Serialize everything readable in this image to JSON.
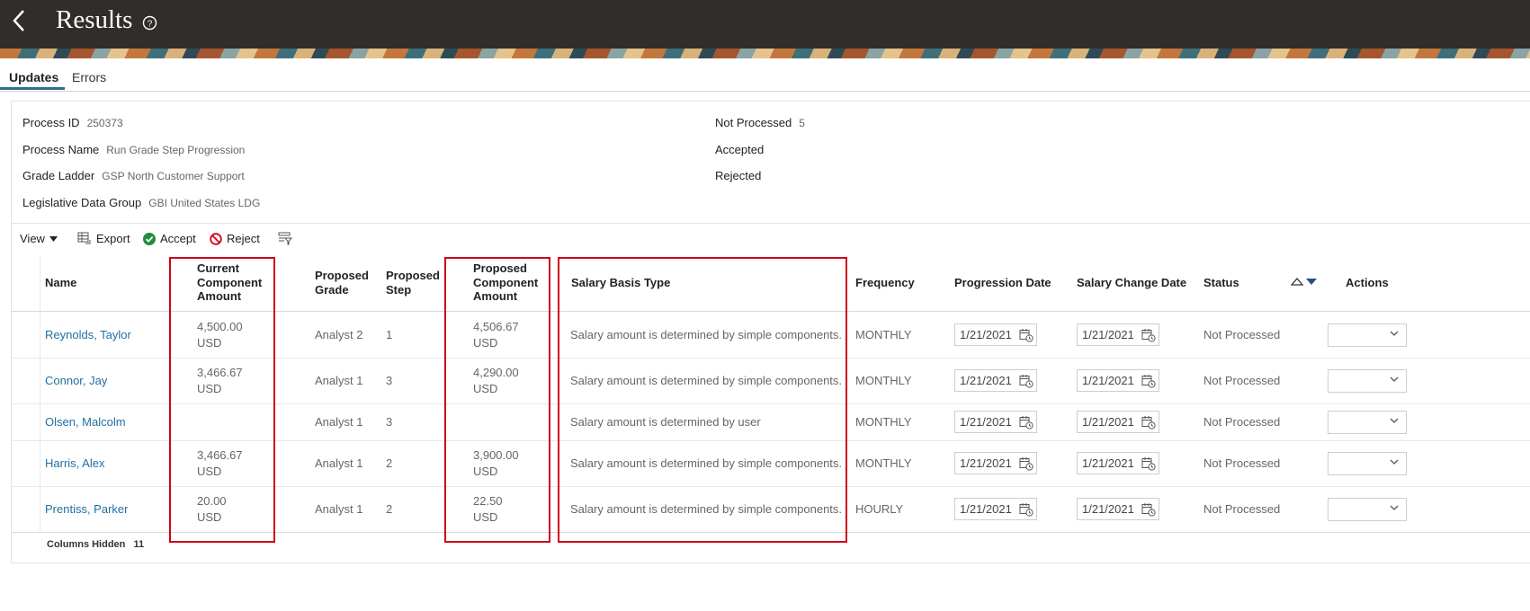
{
  "header": {
    "title": "Results"
  },
  "tabs": [
    {
      "label": "Updates"
    },
    {
      "label": "Errors"
    }
  ],
  "summary": {
    "process_id_label": "Process ID",
    "process_id": "250373",
    "process_name_label": "Process Name",
    "process_name": "Run Grade Step Progression",
    "grade_ladder_label": "Grade Ladder",
    "grade_ladder": "GSP North Customer Support",
    "ldg_label": "Legislative Data Group",
    "ldg": "GBI United States LDG",
    "not_processed_label": "Not Processed",
    "not_processed": "5",
    "accepted_label": "Accepted",
    "rejected_label": "Rejected"
  },
  "toolbar": {
    "view": "View",
    "export": "Export",
    "accept": "Accept",
    "reject": "Reject"
  },
  "columns": {
    "name": "Name",
    "current_amount": [
      "Current",
      "Component",
      "Amount"
    ],
    "proposed_grade": [
      "Proposed",
      "Grade"
    ],
    "proposed_step": [
      "Proposed",
      "Step"
    ],
    "proposed_amount": [
      "Proposed",
      "Component",
      "Amount"
    ],
    "salary_basis_type": "Salary Basis Type",
    "frequency": "Frequency",
    "progression_date": "Progression Date",
    "salary_change_date": "Salary Change Date",
    "status": "Status",
    "actions": "Actions"
  },
  "rows": [
    {
      "name": "Reynolds, Taylor",
      "current_amount": "4,500.00",
      "current_currency": "USD",
      "proposed_grade": "Analyst 2",
      "proposed_step": "1",
      "proposed_amount": "4,506.67",
      "proposed_currency": "USD",
      "salary_basis": "Salary amount is determined by simple components.",
      "frequency": "MONTHLY",
      "progression_date": "1/21/2021",
      "salary_change_date": "1/21/2021",
      "status": "Not Processed"
    },
    {
      "name": "Connor, Jay",
      "current_amount": "3,466.67",
      "current_currency": "USD",
      "proposed_grade": "Analyst 1",
      "proposed_step": "3",
      "proposed_amount": "4,290.00",
      "proposed_currency": "USD",
      "salary_basis": "Salary amount is determined by simple components.",
      "frequency": "MONTHLY",
      "progression_date": "1/21/2021",
      "salary_change_date": "1/21/2021",
      "status": "Not Processed"
    },
    {
      "name": "Olsen, Malcolm",
      "current_amount": "",
      "current_currency": "",
      "proposed_grade": "Analyst 1",
      "proposed_step": "3",
      "proposed_amount": "",
      "proposed_currency": "",
      "salary_basis": "Salary amount is determined by user",
      "frequency": "MONTHLY",
      "progression_date": "1/21/2021",
      "salary_change_date": "1/21/2021",
      "status": "Not Processed"
    },
    {
      "name": "Harris, Alex",
      "current_amount": "3,466.67",
      "current_currency": "USD",
      "proposed_grade": "Analyst 1",
      "proposed_step": "2",
      "proposed_amount": "3,900.00",
      "proposed_currency": "USD",
      "salary_basis": "Salary amount is determined by simple components.",
      "frequency": "MONTHLY",
      "progression_date": "1/21/2021",
      "salary_change_date": "1/21/2021",
      "status": "Not Processed"
    },
    {
      "name": "Prentiss, Parker",
      "current_amount": "20.00",
      "current_currency": "USD",
      "proposed_grade": "Analyst 1",
      "proposed_step": "2",
      "proposed_amount": "22.50",
      "proposed_currency": "USD",
      "salary_basis": "Salary amount is determined by simple components.",
      "frequency": "HOURLY",
      "progression_date": "1/21/2021",
      "salary_change_date": "1/21/2021",
      "status": "Not Processed"
    }
  ],
  "footer": {
    "columns_hidden_label": "Columns Hidden",
    "columns_hidden": "11"
  },
  "colors": {
    "header_bg": "#312d2a",
    "link": "#1f6fa3",
    "highlight": "#d0021b",
    "accept_green": "#1e8e3e",
    "reject_red": "#d0021b"
  }
}
